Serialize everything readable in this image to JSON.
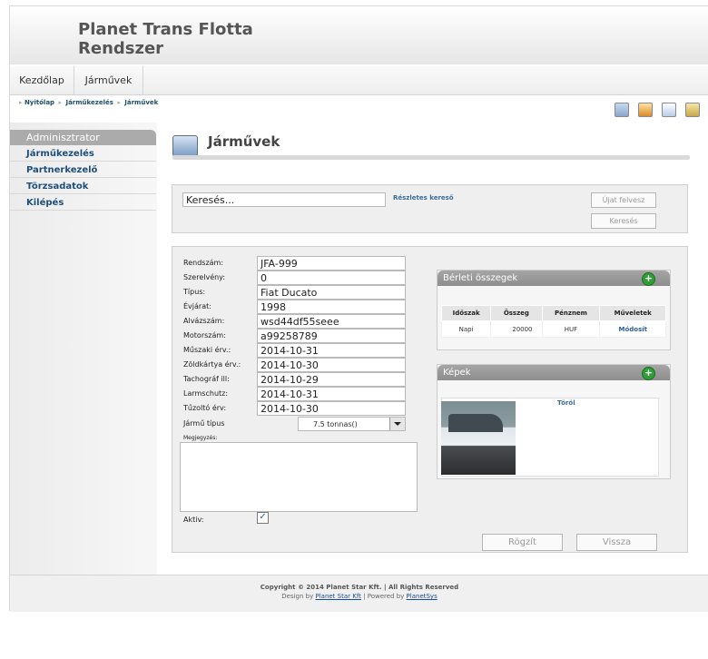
{
  "header": {
    "title_line1": "Planet Trans Flotta",
    "title_line2": "Rendszer"
  },
  "topnav": {
    "items": [
      "Kezdőlap",
      "Járművek"
    ]
  },
  "breadcrumb": {
    "items": [
      "Nyitólap",
      "Járműkezelés",
      "Járművek"
    ]
  },
  "toolbar_icons": [
    "monitor-icon",
    "tools-icon",
    "calendar-icon",
    "key-icon"
  ],
  "sidebar": {
    "admin": "Adminisztrator",
    "items": [
      "Járműkezelés",
      "Partnerkezelő",
      "Törzsadatok",
      "Kilépés"
    ]
  },
  "page": {
    "title": "Járművek"
  },
  "search": {
    "value": "Keresés...",
    "advanced_link": "Részletes kereső",
    "new_button": "Újat felvesz",
    "search_button": "Keresés"
  },
  "form": {
    "fields": [
      {
        "label": "Rendszám:",
        "value": "JFA-999"
      },
      {
        "label": "Szerelvény:",
        "value": "0"
      },
      {
        "label": "Típus:",
        "value": "Fiat Ducato"
      },
      {
        "label": "Évjárat:",
        "value": "1998"
      },
      {
        "label": "Alvázszám:",
        "value": "wsd44df55seee"
      },
      {
        "label": "Motorszám:",
        "value": "a99258789"
      },
      {
        "label": "Műszaki érv.:",
        "value": "2014-10-31"
      },
      {
        "label": "Zöldkártya érv.:",
        "value": "2014-10-30"
      },
      {
        "label": "Tachográf ill:",
        "value": "2014-10-29"
      },
      {
        "label": "Larmschutz:",
        "value": "2014-10-31"
      },
      {
        "label": "Tűzoltó érv:",
        "value": "2014-10-30"
      }
    ],
    "vehicle_type_label": "Jármű típus",
    "vehicle_type_value": "7.5 tonnas()",
    "note_label": "Megjegyzés:",
    "active_label": "Aktiv:",
    "active_checked": true,
    "save_button": "Rögzít",
    "back_button": "Vissza"
  },
  "rental": {
    "title": "Bérleti összegek",
    "columns": [
      "Időszak",
      "Összeg",
      "Pénznem",
      "Műveletek"
    ],
    "rows": [
      {
        "period": "Napi",
        "amount": "20000",
        "currency": "HUF",
        "action": "Módosít"
      }
    ]
  },
  "images": {
    "title": "Képek",
    "delete_link": "Töröl"
  },
  "footer": {
    "copyright": "Copyright © 2014 Planet Star Kft. | All Rights Reserved",
    "design_prefix": "Design by",
    "design_link": "Planet Star Kft",
    "powered_prefix": "| Powered by",
    "powered_link": "PlanetSys"
  }
}
